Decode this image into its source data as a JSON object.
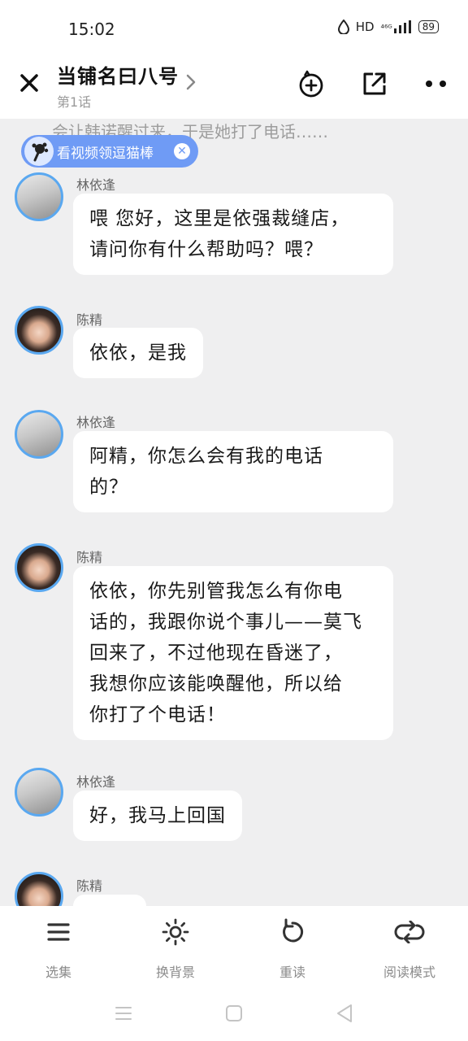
{
  "status_bar": {
    "time": "15:02",
    "network": "HD",
    "signal": "⁴⁶ᴳ",
    "battery": "89"
  },
  "header": {
    "title": "当铺名曰八号",
    "subtitle": "第1话"
  },
  "narration": "会让韩诺醒过来，于是她打了电话……",
  "promo": {
    "label": "看视频领逗猫棒"
  },
  "messages": [
    {
      "speaker": "林依逢",
      "text": "喂 您好，这里是依强裁缝店，\n请问你有什么帮助吗？喂？"
    },
    {
      "speaker": "陈精",
      "text": "依依，是我"
    },
    {
      "speaker": "林依逢",
      "text": "阿精，你怎么会有我的电话\n的？"
    },
    {
      "speaker": "陈精",
      "text": "依依，你先别管我怎么有你电\n话的，我跟你说个事儿——莫飞\n回来了，不过他现在昏迷了，\n我想你应该能唤醒他，所以给\n你打了个电话！"
    },
    {
      "speaker": "林依逢",
      "text": "好，我马上回国"
    },
    {
      "speaker": "陈精",
      "text": ""
    }
  ],
  "bottom_bar": {
    "episodes": "选集",
    "background": "换背景",
    "reread": "重读",
    "read_mode": "阅读模式"
  },
  "colors": {
    "accent": "#6f9bf5",
    "avatar_ring": "#5aa8f0",
    "chat_bg": "#efeff0"
  }
}
